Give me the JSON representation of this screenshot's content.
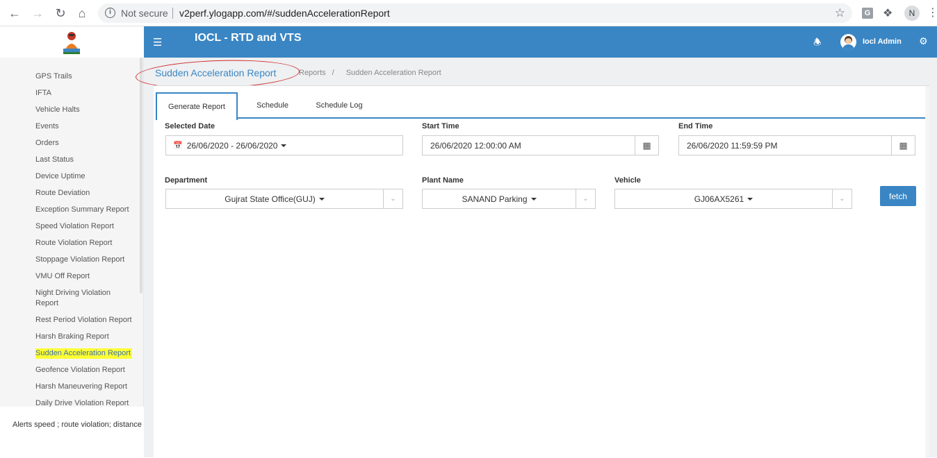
{
  "browser": {
    "security_label": "Not secure",
    "url": "v2perf.ylogapp.com/#/suddenAccelerationReport",
    "extension_g": "G",
    "profile_initial": "N"
  },
  "app": {
    "title": "IOCL - RTD and VTS",
    "user_name": "Iocl Admin"
  },
  "sidebar": {
    "items": [
      "GPS Trails",
      "IFTA",
      "Vehicle Halts",
      "Events",
      "Orders",
      "Last Status",
      "Device Uptime",
      "Route Deviation",
      "Exception Summary Report",
      "Speed Violation Report",
      "Route Violation Report",
      "Stoppage Violation Report",
      "VMU Off Report",
      "Night Driving Violation Report",
      "Rest Period Violation Report",
      "Harsh Braking Report",
      "Sudden Acceleration Report",
      "Geofence Violation Report",
      "Harsh Maneuvering Report",
      "Daily Drive Violation Report"
    ],
    "alerts_text": "Alerts speed ; route violation; distance"
  },
  "breadcrumb": {
    "title": "Sudden Acceleration Report",
    "parent": "Reports",
    "separator": "/",
    "current": "Sudden Acceleration Report"
  },
  "tabs": [
    "Generate Report",
    "Schedule",
    "Schedule Log"
  ],
  "form": {
    "selected_date_label": "Selected Date",
    "selected_date_value": "26/06/2020 - 26/06/2020",
    "start_time_label": "Start Time",
    "start_time_value": "26/06/2020 12:00:00 AM",
    "end_time_label": "End Time",
    "end_time_value": "26/06/2020 11:59:59 PM",
    "department_label": "Department",
    "department_value": "Gujrat State Office(GUJ)",
    "plant_label": "Plant Name",
    "plant_value": "SANAND Parking",
    "vehicle_label": "Vehicle",
    "vehicle_value": "GJ06AX5261",
    "fetch_label": "fetch"
  },
  "colors": {
    "header": "#3a86c4",
    "highlight": "#ffff33",
    "annotation": "#d42828"
  }
}
